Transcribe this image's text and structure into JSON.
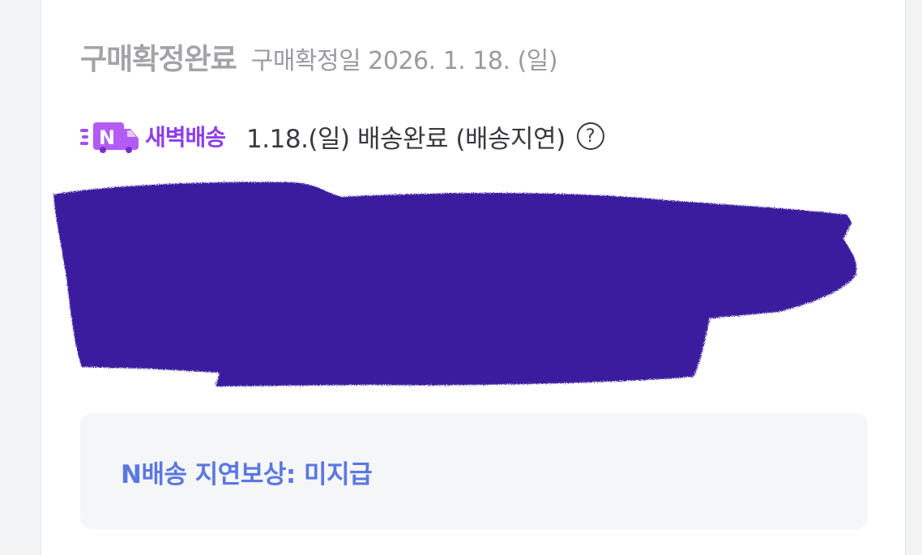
{
  "order": {
    "status_title": "구매확정완료",
    "confirm_date": "구매확정일 2026. 1. 18. (일)"
  },
  "delivery": {
    "badge_label": "새벽배송",
    "badge_icon": "n-delivery-truck-icon",
    "badge_color": "#8e3fe6",
    "status_text": "1.18.(일) 배송완료 (배송지연)",
    "help_symbol": "?"
  },
  "redaction": {
    "color": "#3a1a9e"
  },
  "compensation": {
    "text": "N배송 지연보상: 미지급",
    "color": "#5a78e0"
  }
}
